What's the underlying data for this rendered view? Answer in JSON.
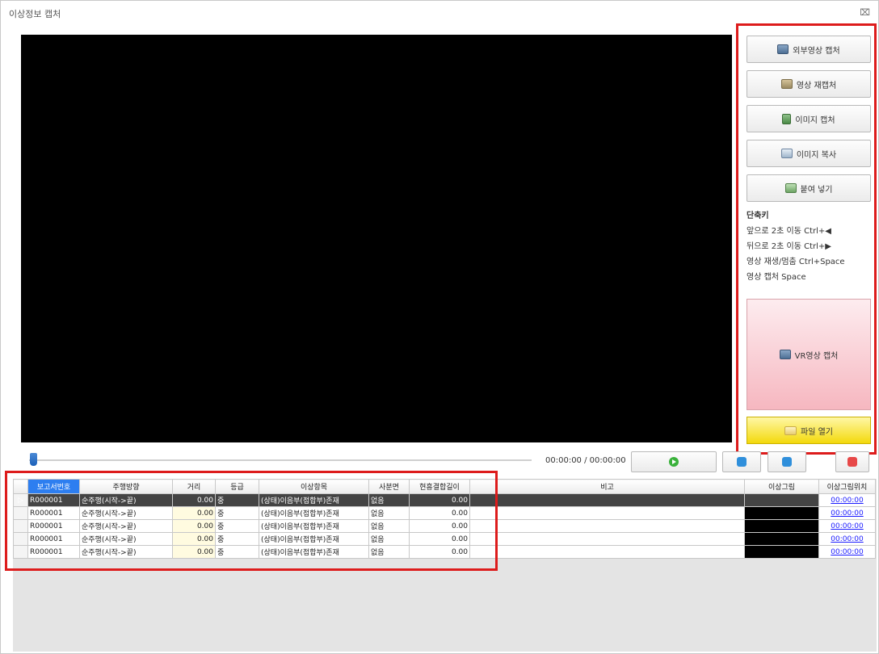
{
  "window": {
    "title": "이상정보 캡처",
    "close": "⌧"
  },
  "right_panel": {
    "buttons": [
      {
        "label": "외부영상 캡처",
        "icon": "camera-icon"
      },
      {
        "label": "영상 재캡처",
        "icon": "recapture-icon"
      },
      {
        "label": "이미지 캡처",
        "icon": "image-icon"
      },
      {
        "label": "이미지 복사",
        "icon": "copy-icon"
      },
      {
        "label": "붙여 넣기",
        "icon": "paste-icon"
      }
    ],
    "shortcut": {
      "title": "단축키",
      "lines": [
        "앞으로 2초 이동 Ctrl+◀",
        "뒤으로 2초 이동 Ctrl+▶",
        "영상 재생/멈춤 Ctrl+Space",
        "영상 캡처 Space"
      ]
    },
    "vr_button": {
      "label": "VR영상 캡처",
      "icon": "camera-icon"
    },
    "file_button": {
      "label": "파일 열기",
      "icon": "folder-icon"
    }
  },
  "player": {
    "time": "00:00:00 / 00:00:00",
    "progress": 0
  },
  "grid": {
    "columns": [
      "보고서번호",
      "주행방향",
      "거리",
      "등급",
      "이상항목",
      "사분면",
      "현흥결합길이",
      "비고",
      "이상그림",
      "이상그림위치"
    ],
    "rows": [
      {
        "id": "R000001",
        "direction": "순주행(시작->끝)",
        "distance": "0.00",
        "grade": "중",
        "item": "(상태)이음부(접합부)존재",
        "quadrant": "없음",
        "length": "0.00",
        "note": "",
        "image": "",
        "image_pos": "00:00:00"
      },
      {
        "id": "R000001",
        "direction": "순주행(시작->끝)",
        "distance": "0.00",
        "grade": "중",
        "item": "(상태)이음부(접합부)존재",
        "quadrant": "없음",
        "length": "0.00",
        "note": "",
        "image": "",
        "image_pos": "00:00:00"
      },
      {
        "id": "R000001",
        "direction": "순주행(시작->끝)",
        "distance": "0.00",
        "grade": "중",
        "item": "(상태)이음부(접합부)존재",
        "quadrant": "없음",
        "length": "0.00",
        "note": "",
        "image": "",
        "image_pos": "00:00:00"
      },
      {
        "id": "R000001",
        "direction": "순주행(시작->끝)",
        "distance": "0.00",
        "grade": "중",
        "item": "(상태)이음부(접합부)존재",
        "quadrant": "없음",
        "length": "0.00",
        "note": "",
        "image": "",
        "image_pos": "00:00:00"
      },
      {
        "id": "R000001",
        "direction": "순주행(시작->끝)",
        "distance": "0.00",
        "grade": "중",
        "item": "(상태)이음부(접합부)존재",
        "quadrant": "없음",
        "length": "0.00",
        "note": "",
        "image": "",
        "image_pos": "00:00:00"
      }
    ]
  },
  "colors": {
    "highlight": "#dd1c1c",
    "selected_header": "#2d7ef0",
    "vr_button": "#f6b7c0",
    "file_button": "#f3d90c"
  }
}
